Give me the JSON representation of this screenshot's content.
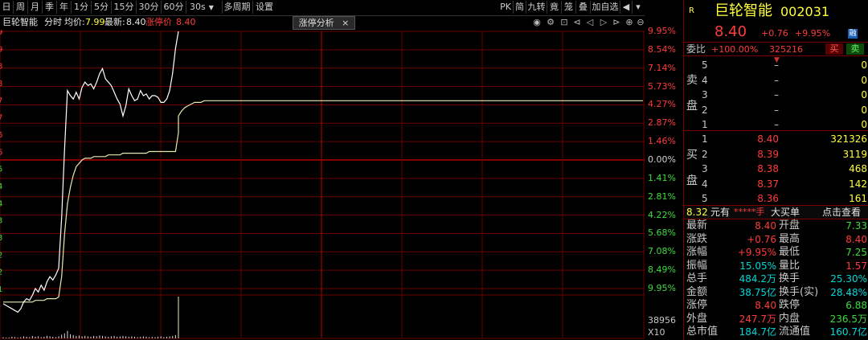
{
  "toolbar": {
    "periods": [
      "日",
      "周",
      "月",
      "季",
      "年",
      "1分",
      "5分",
      "15分",
      "30分",
      "60分"
    ],
    "period_select": "30s",
    "multi_period": "多周期",
    "settings": "设置",
    "right_items": [
      "PK",
      "简",
      "九转",
      "竟",
      "笼",
      "叠",
      "加自选"
    ]
  },
  "title_bar": {
    "stock_name": "巨轮智能",
    "mode": "分时",
    "avg_label": "均价:",
    "avg_value": "7.99",
    "latest_label": "最新:",
    "latest_value": "8.40",
    "limit_label": "涨停价",
    "limit_value": "8.40",
    "tab_label": "涨停分析",
    "tab_close": "×"
  },
  "left_edge_labels": [
    "9",
    "9",
    "8",
    "8",
    "7",
    "7",
    "6",
    "6",
    "5",
    "4",
    "4",
    "3",
    "3",
    "2",
    "2",
    "1"
  ],
  "chart_data": {
    "type": "line",
    "title": "",
    "prev_close": 7.64,
    "y_pct_labels": [
      "9.95%",
      "8.54%",
      "7.14%",
      "5.73%",
      "4.27%",
      "2.87%",
      "1.46%",
      "0.00%",
      "1.41%",
      "2.81%",
      "4.22%",
      "5.68%",
      "7.08%",
      "8.49%",
      "9.95%"
    ],
    "volume_labels": [
      "38956",
      "X10"
    ],
    "series": [
      {
        "name": "price",
        "values": [
          6.79,
          6.78,
          6.77,
          6.76,
          6.75,
          6.74,
          6.76,
          6.8,
          6.82,
          6.81,
          6.84,
          6.88,
          6.86,
          6.9,
          6.87,
          6.92,
          6.95,
          6.93,
          6.96,
          7.0,
          7.3,
          7.7,
          8.05,
          8.02,
          8.0,
          8.04,
          8.0,
          8.07,
          8.1,
          8.08,
          8.09,
          8.06,
          8.1,
          8.15,
          8.18,
          8.12,
          8.1,
          8.08,
          8.04,
          8.0,
          7.97,
          7.9,
          7.96,
          8.06,
          8.02,
          7.99,
          8.0,
          8.05,
          8.02,
          8.03,
          8.0,
          8.02,
          8.02,
          8.01,
          7.98,
          7.98,
          8.0,
          8.05,
          8.15,
          8.3,
          8.4
        ],
        "color": "#ffffff"
      },
      {
        "name": "avg",
        "values": [
          6.8,
          6.8,
          6.8,
          6.8,
          6.8,
          6.8,
          6.8,
          6.8,
          6.8,
          6.8,
          6.8,
          6.81,
          6.81,
          6.81,
          6.81,
          6.82,
          6.82,
          6.82,
          6.82,
          6.83,
          6.95,
          7.2,
          7.38,
          7.48,
          7.55,
          7.6,
          7.62,
          7.64,
          7.65,
          7.65,
          7.65,
          7.66,
          7.66,
          7.66,
          7.66,
          7.66,
          7.67,
          7.67,
          7.67,
          7.67,
          7.67,
          7.68,
          7.68,
          7.68,
          7.68,
          7.68,
          7.68,
          7.68,
          7.68,
          7.68,
          7.69,
          7.69,
          7.69,
          7.69,
          7.69,
          7.69,
          7.69,
          7.69,
          7.69,
          7.69,
          7.8,
          7.9,
          7.93,
          7.95,
          7.96,
          7.97,
          7.98,
          7.98,
          7.98,
          7.99,
          7.99
        ],
        "color": "#e8e8b0"
      }
    ],
    "volume": [
      3,
      2,
      2,
      4,
      3,
      2,
      3,
      5,
      4,
      3,
      6,
      4,
      5,
      3,
      4,
      6,
      5,
      4,
      3,
      5,
      9,
      12,
      18,
      10,
      8,
      6,
      7,
      5,
      6,
      5,
      4,
      6,
      5,
      7,
      6,
      5,
      4,
      5,
      6,
      4,
      5,
      6,
      5,
      4,
      5,
      4,
      3,
      4,
      5,
      4,
      3,
      4,
      3,
      4,
      5,
      3,
      4,
      5,
      6,
      8,
      100
    ]
  },
  "quote": {
    "badge": "R",
    "name": "巨轮智能",
    "code": "002031",
    "price": "8.40",
    "change": "+0.76",
    "change_pct": "+9.95%",
    "rzrq": "融",
    "weibi_label": "委比",
    "weibi_value": "+100.00%",
    "weicha_value": "325216",
    "buy_btn": "买",
    "sell_btn": "卖",
    "sell_side_label": [
      "卖",
      "盘"
    ],
    "buy_side_label": [
      "买",
      "盘"
    ],
    "asks": [
      {
        "level": "5",
        "price": "–",
        "vol": "0"
      },
      {
        "level": "4",
        "price": "–",
        "vol": "0"
      },
      {
        "level": "3",
        "price": "–",
        "vol": "0"
      },
      {
        "level": "2",
        "price": "–",
        "vol": "0"
      },
      {
        "level": "1",
        "price": "–",
        "vol": "0"
      }
    ],
    "bids": [
      {
        "level": "1",
        "price": "8.40",
        "vol": "321326"
      },
      {
        "level": "2",
        "price": "8.39",
        "vol": "3119"
      },
      {
        "level": "3",
        "price": "8.38",
        "vol": "468"
      },
      {
        "level": "4",
        "price": "8.37",
        "vol": "142"
      },
      {
        "level": "5",
        "price": "8.36",
        "vol": "161"
      }
    ],
    "big_order": {
      "price": "8.32",
      "unit": "元有",
      "stars": "*****手",
      "label": "大买单",
      "link": "点击查看"
    },
    "stats": [
      {
        "l1": "最新",
        "v1": "8.40",
        "c1": "red",
        "l2": "开盘",
        "v2": "7.33",
        "c2": "grn"
      },
      {
        "l1": "涨跌",
        "v1": "+0.76",
        "c1": "red",
        "l2": "最高",
        "v2": "8.40",
        "c2": "red"
      },
      {
        "l1": "涨幅",
        "v1": "+9.95%",
        "c1": "red",
        "l2": "最低",
        "v2": "7.25",
        "c2": "grn"
      },
      {
        "l1": "振幅",
        "v1": "15.05%",
        "c1": "cy",
        "l2": "量比",
        "v2": "1.57",
        "c2": "red"
      },
      {
        "l1": "总手",
        "v1": "484.2万",
        "c1": "cy",
        "l2": "换手",
        "v2": "25.30%",
        "c2": "cy"
      },
      {
        "l1": "金额",
        "v1": "38.75亿",
        "c1": "cy",
        "l2": "换手(实)",
        "v2": "28.48%",
        "c2": "cy"
      },
      {
        "l1": "涨停",
        "v1": "8.40",
        "c1": "red",
        "l2": "跌停",
        "v2": "6.88",
        "c2": "grn"
      },
      {
        "l1": "外盘",
        "v1": "247.7万",
        "c1": "red",
        "l2": "内盘",
        "v2": "236.5万",
        "c2": "grn"
      },
      {
        "l1": "总市值",
        "v1": "184.7亿",
        "c1": "cy",
        "l2": "流通值",
        "v2": "160.7亿",
        "c2": "cy"
      }
    ]
  }
}
